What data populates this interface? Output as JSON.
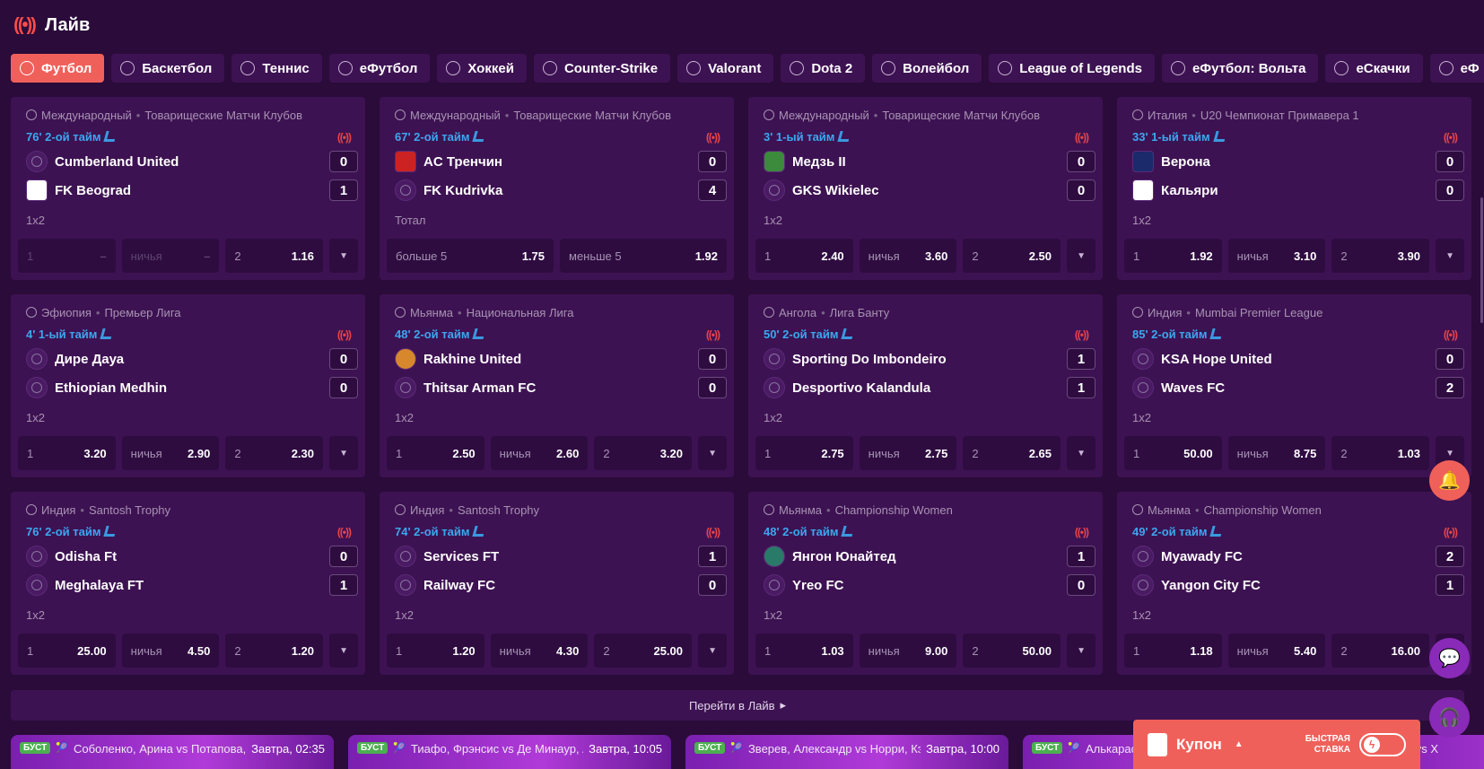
{
  "header": {
    "title": "Лайв"
  },
  "tabs": [
    {
      "label": "Футбол",
      "icon": "football-icon",
      "active": true
    },
    {
      "label": "Баскетбол",
      "icon": "basketball-icon"
    },
    {
      "label": "Теннис",
      "icon": "tennis-icon"
    },
    {
      "label": "еФутбол",
      "icon": "efootball-icon"
    },
    {
      "label": "Хоккей",
      "icon": "hockey-icon"
    },
    {
      "label": "Counter-Strike",
      "icon": "counter-strike-icon"
    },
    {
      "label": "Valorant",
      "icon": "valorant-icon"
    },
    {
      "label": "Dota 2",
      "icon": "dota-icon"
    },
    {
      "label": "Волейбол",
      "icon": "volleyball-icon"
    },
    {
      "label": "League of Legends",
      "icon": "lol-icon"
    },
    {
      "label": "еФутбол: Вольта",
      "icon": "volta-icon"
    },
    {
      "label": "еСкачки",
      "icon": "horse-racing-icon"
    },
    {
      "label": "еФ",
      "icon": "penalty-icon"
    }
  ],
  "matches": [
    {
      "country": "Международный",
      "league": "Товарищеские Матчи Клубов",
      "status": "76' 2-ой тайм",
      "team1": {
        "name": "Cumberland United",
        "score": "0",
        "logo": "default"
      },
      "team2": {
        "name": "FK Beograd",
        "score": "1",
        "logo": "white"
      },
      "market": "1x2",
      "odds": [
        {
          "label": "1",
          "value": "–",
          "disabled": true
        },
        {
          "label": "ничья",
          "value": "–",
          "disabled": true
        },
        {
          "label": "2",
          "value": "1.16"
        }
      ],
      "more": true
    },
    {
      "country": "Международный",
      "league": "Товарищеские Матчи Клубов",
      "status": "67' 2-ой тайм",
      "team1": {
        "name": "AC Тренчин",
        "score": "0",
        "logo": "red"
      },
      "team2": {
        "name": "FK Kudrivka",
        "score": "4",
        "logo": "default"
      },
      "market": "Тотал",
      "odds": [
        {
          "label": "больше 5",
          "value": "1.75"
        },
        {
          "label": "меньше 5",
          "value": "1.92"
        }
      ],
      "more": false
    },
    {
      "country": "Международный",
      "league": "Товарищеские Матчи Клубов",
      "status": "3' 1-ый тайм",
      "team1": {
        "name": "Медзь II",
        "score": "0",
        "logo": "green"
      },
      "team2": {
        "name": "GKS Wikielec",
        "score": "0",
        "logo": "default"
      },
      "market": "1x2",
      "odds": [
        {
          "label": "1",
          "value": "2.40"
        },
        {
          "label": "ничья",
          "value": "3.60"
        },
        {
          "label": "2",
          "value": "2.50"
        }
      ],
      "more": true
    },
    {
      "country": "Италия",
      "league": "U20 Чемпионат Примавера 1",
      "status": "33' 1-ый тайм",
      "team1": {
        "name": "Верона",
        "score": "0",
        "logo": "navy"
      },
      "team2": {
        "name": "Кальяри",
        "score": "0",
        "logo": "white"
      },
      "market": "1x2",
      "odds": [
        {
          "label": "1",
          "value": "1.92"
        },
        {
          "label": "ничья",
          "value": "3.10"
        },
        {
          "label": "2",
          "value": "3.90"
        }
      ],
      "more": true
    },
    {
      "country": "Эфиопия",
      "league": "Премьер Лига",
      "status": "4' 1-ый тайм",
      "team1": {
        "name": "Дире Дауа",
        "score": "0",
        "logo": "default"
      },
      "team2": {
        "name": "Ethiopian Medhin",
        "score": "0",
        "logo": "default"
      },
      "market": "1x2",
      "odds": [
        {
          "label": "1",
          "value": "3.20"
        },
        {
          "label": "ничья",
          "value": "2.90"
        },
        {
          "label": "2",
          "value": "2.30"
        }
      ],
      "more": true
    },
    {
      "country": "Мьянма",
      "league": "Национальная Лига",
      "status": "48' 2-ой тайм",
      "team1": {
        "name": "Rakhine United",
        "score": "0",
        "logo": "orange"
      },
      "team2": {
        "name": "Thitsar Arman FC",
        "score": "0",
        "logo": "default"
      },
      "market": "1x2",
      "odds": [
        {
          "label": "1",
          "value": "2.50"
        },
        {
          "label": "ничья",
          "value": "2.60"
        },
        {
          "label": "2",
          "value": "3.20"
        }
      ],
      "more": true
    },
    {
      "country": "Ангола",
      "league": "Лига Банту",
      "status": "50' 2-ой тайм",
      "team1": {
        "name": "Sporting Do Imbondeiro",
        "score": "1",
        "logo": "default"
      },
      "team2": {
        "name": "Desportivo Kalandula",
        "score": "1",
        "logo": "default"
      },
      "market": "1x2",
      "odds": [
        {
          "label": "1",
          "value": "2.75"
        },
        {
          "label": "ничья",
          "value": "2.75"
        },
        {
          "label": "2",
          "value": "2.65"
        }
      ],
      "more": true
    },
    {
      "country": "Индия",
      "league": "Mumbai Premier League",
      "status": "85' 2-ой тайм",
      "team1": {
        "name": "KSA Hope United",
        "score": "0",
        "logo": "default"
      },
      "team2": {
        "name": "Waves FC",
        "score": "2",
        "logo": "default"
      },
      "market": "1x2",
      "odds": [
        {
          "label": "1",
          "value": "50.00"
        },
        {
          "label": "ничья",
          "value": "8.75"
        },
        {
          "label": "2",
          "value": "1.03"
        }
      ],
      "more": true
    },
    {
      "country": "Индия",
      "league": "Santosh Trophy",
      "status": "76' 2-ой тайм",
      "team1": {
        "name": "Odisha Ft",
        "score": "0",
        "logo": "default"
      },
      "team2": {
        "name": "Meghalaya FT",
        "score": "1",
        "logo": "default"
      },
      "market": "1x2",
      "odds": [
        {
          "label": "1",
          "value": "25.00"
        },
        {
          "label": "ничья",
          "value": "4.50"
        },
        {
          "label": "2",
          "value": "1.20"
        }
      ],
      "more": true
    },
    {
      "country": "Индия",
      "league": "Santosh Trophy",
      "status": "74' 2-ой тайм",
      "team1": {
        "name": "Services FT",
        "score": "1",
        "logo": "default"
      },
      "team2": {
        "name": "Railway FC",
        "score": "0",
        "logo": "default"
      },
      "market": "1x2",
      "odds": [
        {
          "label": "1",
          "value": "1.20"
        },
        {
          "label": "ничья",
          "value": "4.30"
        },
        {
          "label": "2",
          "value": "25.00"
        }
      ],
      "more": true
    },
    {
      "country": "Мьянма",
      "league": "Championship Women",
      "status": "48' 2-ой тайм",
      "team1": {
        "name": "Янгон Юнайтед",
        "score": "1",
        "logo": "teal"
      },
      "team2": {
        "name": "Yreo FC",
        "score": "0",
        "logo": "default"
      },
      "market": "1x2",
      "odds": [
        {
          "label": "1",
          "value": "1.03"
        },
        {
          "label": "ничья",
          "value": "9.00"
        },
        {
          "label": "2",
          "value": "50.00"
        }
      ],
      "more": true
    },
    {
      "country": "Мьянма",
      "league": "Championship Women",
      "status": "49' 2-ой тайм",
      "team1": {
        "name": "Myawady FC",
        "score": "2",
        "logo": "default"
      },
      "team2": {
        "name": "Yangon City FC",
        "score": "1",
        "logo": "default"
      },
      "market": "1x2",
      "odds": [
        {
          "label": "1",
          "value": "1.18"
        },
        {
          "label": "ничья",
          "value": "5.40"
        },
        {
          "label": "2",
          "value": "16.00"
        }
      ],
      "more": true
    }
  ],
  "goto_live": "Перейти в Лайв",
  "promos": [
    {
      "badge": "БУСТ",
      "text": "Соболенко, Арина vs Потапова, Ан",
      "time": "Завтра, 02:35"
    },
    {
      "badge": "БУСТ",
      "text": "Тиафо, Фрэнсис vs Де Минаур, Алекс",
      "time": "Завтра, 10:05"
    },
    {
      "badge": "БУСТ",
      "text": "Зверев, Александр vs Норри, Кэмерон",
      "time": "Завтра, 10:00"
    },
    {
      "badge": "БУСТ",
      "text": "Алькарас",
      "time": ""
    },
    {
      "badge": "",
      "text": "Жирона vs Х",
      "time": ""
    }
  ],
  "coupon": {
    "label": "Купон",
    "quick_bet_line1": "БЫСТРАЯ",
    "quick_bet_line2": "СТАВКА"
  },
  "colors": {
    "background": "#2a0b3a",
    "card": "#3d1252",
    "accent": "#f0605a",
    "status_blue": "#3aa8f0",
    "live_red": "#e6434a"
  }
}
